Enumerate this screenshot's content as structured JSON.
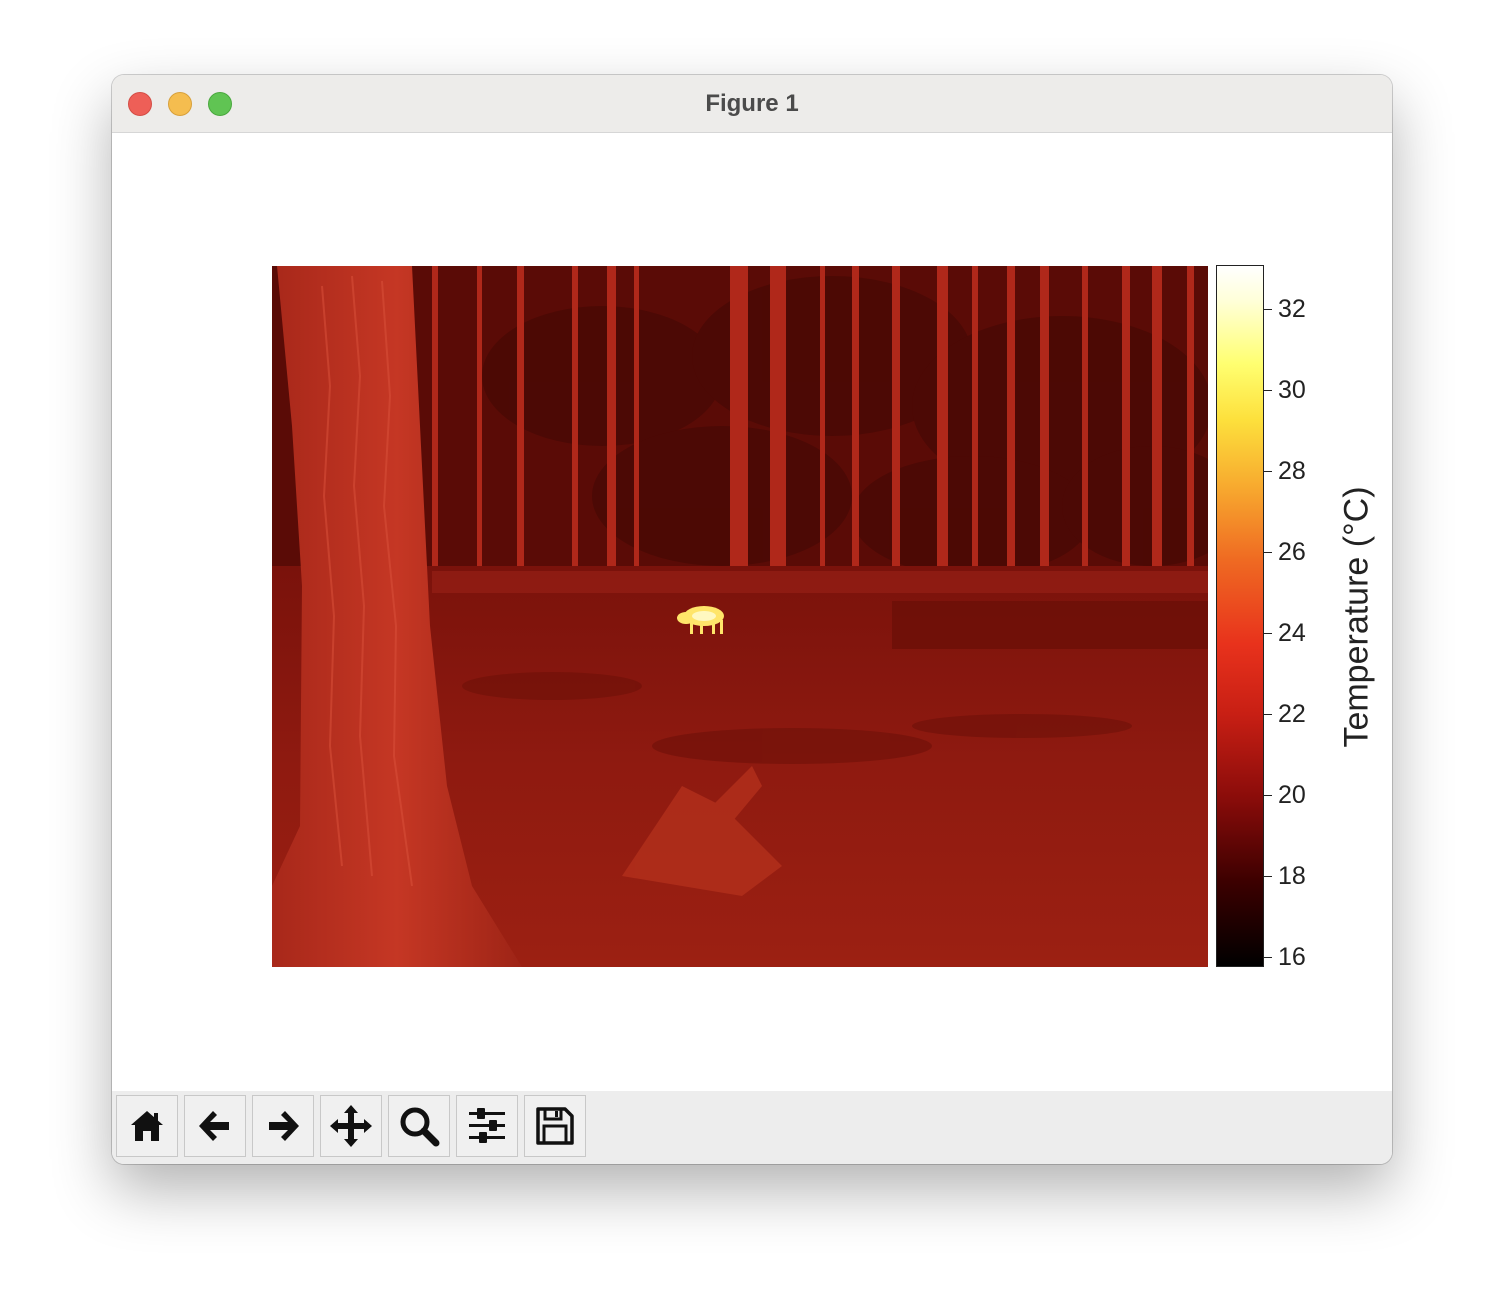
{
  "window": {
    "title": "Figure 1"
  },
  "toolbar": {
    "buttons": [
      {
        "icon": "home-icon",
        "label": "Home"
      },
      {
        "icon": "arrow-left-icon",
        "label": "Back"
      },
      {
        "icon": "arrow-right-icon",
        "label": "Forward"
      },
      {
        "icon": "move-icon",
        "label": "Pan"
      },
      {
        "icon": "zoom-icon",
        "label": "Zoom"
      },
      {
        "icon": "sliders-icon",
        "label": "Configure subplots"
      },
      {
        "icon": "save-icon",
        "label": "Save"
      }
    ]
  },
  "colorbar": {
    "label": "Temperature (°C)",
    "ticks": [
      "16",
      "18",
      "20",
      "22",
      "24",
      "26",
      "28",
      "30",
      "32"
    ],
    "range": [
      15.6,
      33.0
    ],
    "colormap": "hot"
  },
  "colors": {
    "titlebar": "#edecea",
    "close": "#ee5f57",
    "minimize": "#f5bd4f",
    "zoom": "#60c453",
    "thermal_background": "#8f1810",
    "hot_spot": "#fff06a"
  }
}
